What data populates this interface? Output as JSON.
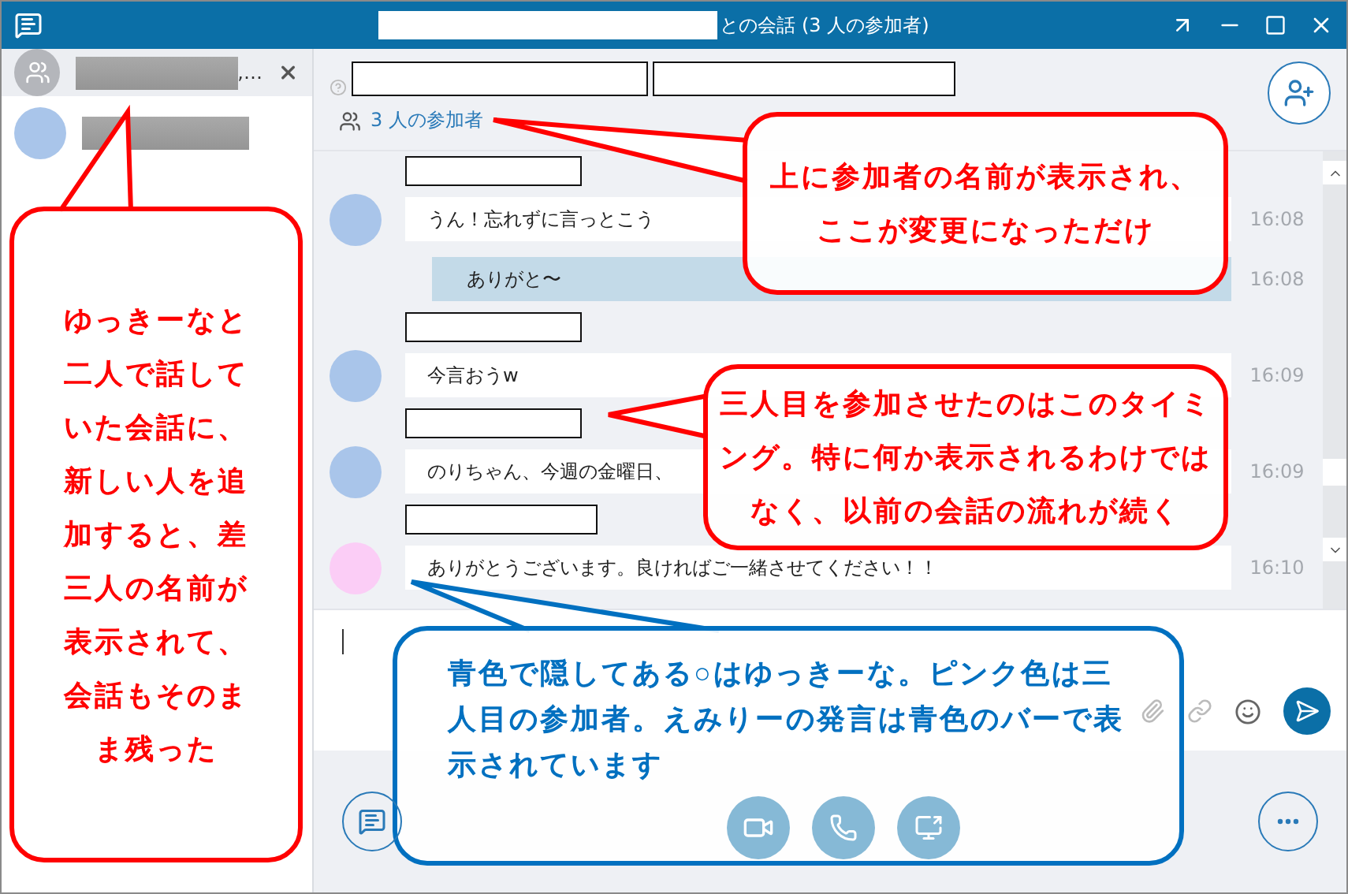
{
  "window": {
    "title": "との会話 (3 人の参加者)"
  },
  "conversations": [
    {
      "kind": "group",
      "name_suffix": ",…",
      "selected": true
    },
    {
      "kind": "person",
      "selected": false
    }
  ],
  "header": {
    "participants": "3 人の参加者"
  },
  "messages": [
    {
      "kind": "received",
      "color": "#a9c5ea",
      "text": "うん！忘れずに言っとこう",
      "time": "16:08"
    },
    {
      "kind": "sent",
      "text": "ありがと〜",
      "time": "16:08"
    },
    {
      "kind": "received",
      "color": "#a9c5ea",
      "text": "今言おうw",
      "time": "16:09"
    },
    {
      "kind": "received",
      "color": "#a9c5ea",
      "text": "のりちゃん、今週の金曜日、",
      "time": "16:09"
    },
    {
      "kind": "received",
      "color": "#fbcdf6",
      "text": "ありがとうございます。良ければご一緒させてください！！",
      "time": "16:10"
    }
  ],
  "annotations": [
    {
      "color": "#ff0000",
      "text": "上に参加者の名前が表示され、ここが変更になっただけ"
    },
    {
      "color": "#ff0000",
      "text": "ゆっきーなと二人で話していた会話に、新しい人を追加すると、差三人の名前が表示されて、会話もそのまま残った"
    },
    {
      "color": "#ff0000",
      "text": "三人目を参加させたのはこのタイミング。特に何か表示されるわけではなく、以前の会話の流れが続く"
    },
    {
      "color": "#0070c0",
      "text": "青色で隠してある○はゆっきーな。ピンク色は三人目の参加者。えみりーの発言は青色のバーで表示されています"
    }
  ]
}
